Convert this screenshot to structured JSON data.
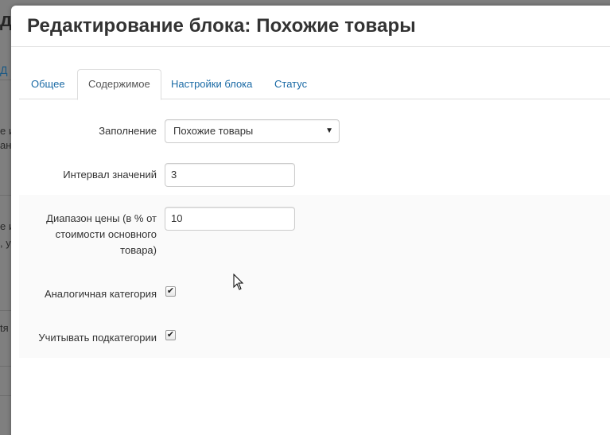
{
  "background": {
    "fragments": [
      "да",
      "Д",
      "е и",
      "ан",
      "е и",
      ", у",
      "tя"
    ]
  },
  "modal": {
    "title": "Редактирование блока: Похожие товары"
  },
  "tabs": [
    {
      "label": "Общее",
      "active": false
    },
    {
      "label": "Содержимое",
      "active": true
    },
    {
      "label": "Настройки блока",
      "active": false
    },
    {
      "label": "Статус",
      "active": false
    }
  ],
  "form": {
    "fill_label": "Заполнение",
    "fill_value": "Похожие товары",
    "interval_label": "Интервал значений",
    "interval_value": "3",
    "price_range_label": "Диапазон цены (в % от стоимости основного товара)",
    "price_range_value": "10",
    "similar_category_label": "Аналогичная категория",
    "similar_category_checked": true,
    "subcategories_label": "Учитывать подкатегории",
    "subcategories_checked": true
  },
  "icons": {
    "select_caret": "chevron-down-icon",
    "checkmark": "check-icon",
    "cursor": "mouse-pointer-icon"
  },
  "colors": {
    "tab_link": "#1a6aa5",
    "active_tab_text": "#555555",
    "overlay": "#7f7f7f"
  }
}
